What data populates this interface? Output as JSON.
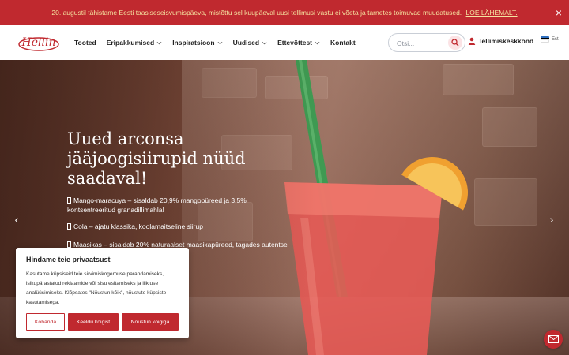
{
  "announcement": {
    "text": "20. augustil tähistame Eesti taasiseseisvumispäeva, mistõttu sel kuupäeval uusi tellimusi vastu ei võeta ja tarnetes toimuvad muudatused.",
    "link": "LOE LÄHEMALT.",
    "close_icon": "×"
  },
  "header": {
    "logo_text": "Hellin",
    "nav": [
      {
        "label": "Tooted",
        "has_dropdown": false
      },
      {
        "label": "Eripakkumised",
        "has_dropdown": true
      },
      {
        "label": "Inspiratsioon",
        "has_dropdown": true
      },
      {
        "label": "Uudised",
        "has_dropdown": true
      },
      {
        "label": "Ettevõttest",
        "has_dropdown": true
      },
      {
        "label": "Kontakt",
        "has_dropdown": false
      }
    ],
    "search_placeholder": "Otsi...",
    "order_center": "Tellimiskeskkond",
    "language": "Est"
  },
  "hero": {
    "title": "Uued arconsa jääjoogisiirupid nüüd saadaval!",
    "bullets": [
      "Mango-maracuya – sisaldab 20,9% mangopüreed ja 3,5% kontsentreeritud granadillimahla!",
      "Cola – ajatu klassika, koolamaitseline siirup",
      "Maasikas – sisaldab 20% naturaalset maasikapüreed, tagades autentse"
    ],
    "prev_icon": "‹",
    "next_icon": "›"
  },
  "cookie": {
    "title": "Hindame teie privaatsust",
    "text": "Kasutame küpsiseid teie sirvimiskogemuse parandamiseks, isikupärastatud reklaamide või sisu esitamiseks ja liikluse analüüsimiseks. Klõpsates \"Nõustun kõik\", nõustute küpsiste kasutamisega.",
    "btn_customize": "Kohanda",
    "btn_reject": "Keeldu kõigist",
    "btn_accept": "Nõustun kõigiga"
  },
  "colors": {
    "brand_red": "#c0292f",
    "announce_text": "#f4e3a0"
  }
}
